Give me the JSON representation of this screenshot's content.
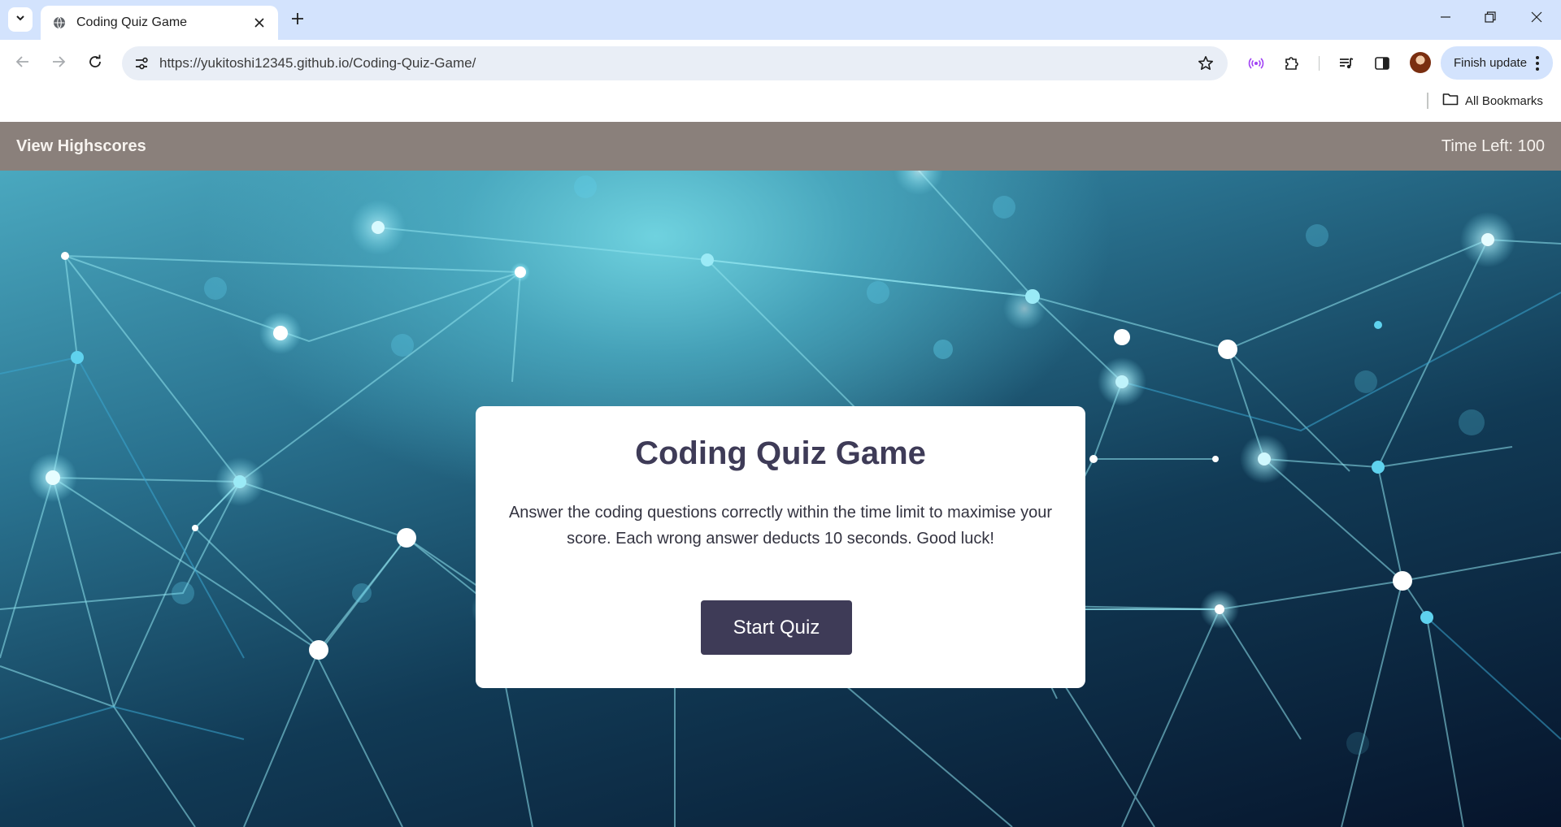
{
  "browser": {
    "tab": {
      "title": "Coding Quiz Game"
    },
    "address_bar": {
      "url": "https://yukitoshi12345.github.io/Coding-Quiz-Game/"
    },
    "finish_update_label": "Finish update",
    "bookmarks": {
      "all_bookmarks_label": "All Bookmarks"
    },
    "icons": [
      "tab-search-icon",
      "globe-icon",
      "close-icon",
      "plus-icon",
      "minimize-icon",
      "restore-icon",
      "close-window-icon",
      "back-arrow-icon",
      "forward-arrow-icon",
      "reload-icon",
      "site-info-icon",
      "star-icon",
      "broadcast-icon",
      "puzzle-icon",
      "media-icon",
      "sidepanel-icon",
      "kebab-icon",
      "folder-icon"
    ]
  },
  "page": {
    "header": {
      "view_highscores": "View Highscores",
      "time_left": "Time Left: 100"
    },
    "card": {
      "title": "Coding Quiz Game",
      "description": "Answer the coding questions correctly within the time limit to maximise your score. Each wrong answer deducts 10 seconds. Good luck!",
      "start_button": "Start Quiz"
    }
  },
  "colors": {
    "header_bg": "#8a807b",
    "card_title": "#3e3b57",
    "button_bg": "#3e3b57",
    "tabstrip_bg": "#d3e3fd"
  }
}
